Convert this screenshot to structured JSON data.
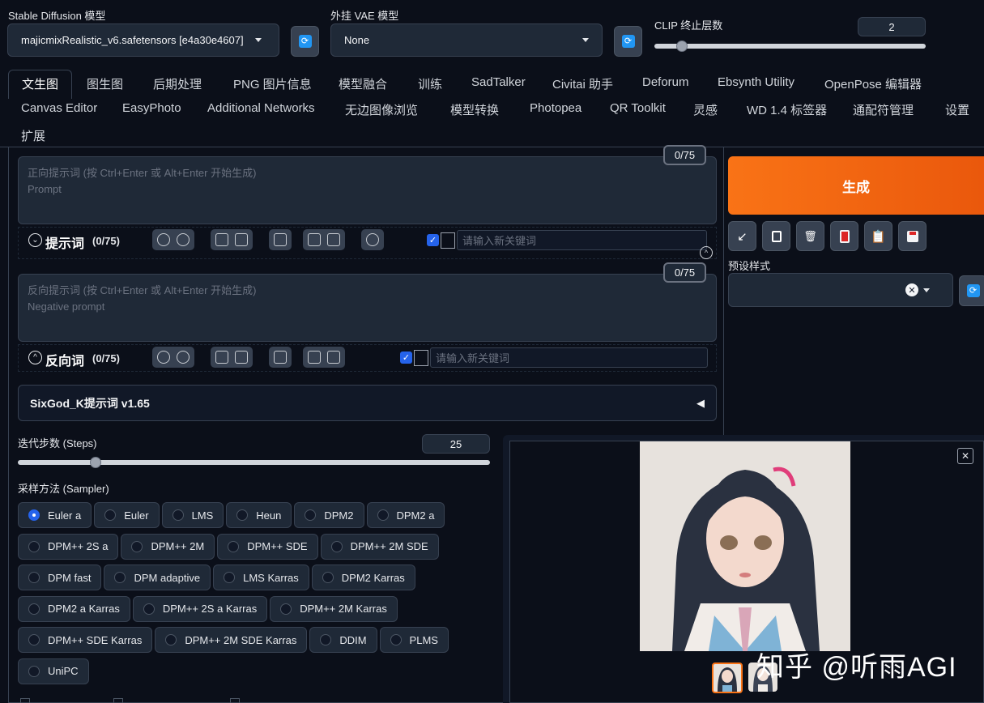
{
  "top": {
    "sd_model_label": "Stable Diffusion 模型",
    "sd_model_value": "majicmixRealistic_v6.safetensors [e4a30e4607]",
    "vae_label": "外挂 VAE 模型",
    "vae_value": "None",
    "clip_label": "CLIP 终止层数",
    "clip_value": "2",
    "clip_level": 0.1
  },
  "tabs": {
    "row1": [
      "文生图",
      "图生图",
      "后期处理",
      "PNG 图片信息",
      "模型融合",
      "训练",
      "SadTalker",
      "Civitai 助手",
      "Deforum",
      "Ebsynth Utility",
      "OpenPose 编辑器"
    ],
    "row2": [
      "Canvas Editor",
      "EasyPhoto",
      "Additional Networks",
      "无边图像浏览",
      "模型转换",
      "Photopea",
      "QR Toolkit",
      "灵感",
      "WD 1.4 标签器",
      "通配符管理",
      "设置"
    ],
    "row3": [
      "扩展"
    ],
    "active": "文生图"
  },
  "prompt": {
    "counter": "0/75",
    "placeholder1": "正向提示词 (按 Ctrl+Enter 或 Alt+Enter 开始生成)",
    "placeholder2": "Prompt",
    "toolbar_title": "提示词",
    "toolbar_count": "(0/75)",
    "keyword_placeholder": "请输入新关键词"
  },
  "negative": {
    "counter": "0/75",
    "placeholder1": "反向提示词 (按 Ctrl+Enter 或 Alt+Enter 开始生成)",
    "placeholder2": "Negative prompt",
    "toolbar_title": "反向词",
    "toolbar_count": "(0/75)",
    "keyword_placeholder": "请输入新关键词"
  },
  "sixgod": {
    "title": "SixGod_K提示词 v1.65",
    "arrow": "◀"
  },
  "steps": {
    "label": "迭代步数 (Steps)",
    "value": "25",
    "level": 0.165
  },
  "sampler": {
    "label": "采样方法 (Sampler)",
    "selected": "Euler a",
    "rows": [
      [
        "Euler a",
        "Euler",
        "LMS",
        "Heun",
        "DPM2",
        "DPM2 a"
      ],
      [
        "DPM++ 2S a",
        "DPM++ 2M",
        "DPM++ SDE",
        "DPM++ 2M SDE"
      ],
      [
        "DPM fast",
        "DPM adaptive",
        "LMS Karras",
        "DPM2 Karras"
      ],
      [
        "DPM2 a Karras",
        "DPM++ 2S a Karras",
        "DPM++ 2M Karras"
      ],
      [
        "DPM++ SDE Karras",
        "DPM++ 2M SDE Karras",
        "DDIM",
        "PLMS"
      ],
      [
        "UniPC"
      ]
    ]
  },
  "generate": {
    "label": "生成"
  },
  "styles": {
    "label": "预设样式"
  },
  "watermark": "知乎 @听雨AGI",
  "colors": {
    "accent": "#f97316",
    "bg": "#0b0f19",
    "panel": "#1f2937",
    "checkbox": "#2563eb"
  }
}
